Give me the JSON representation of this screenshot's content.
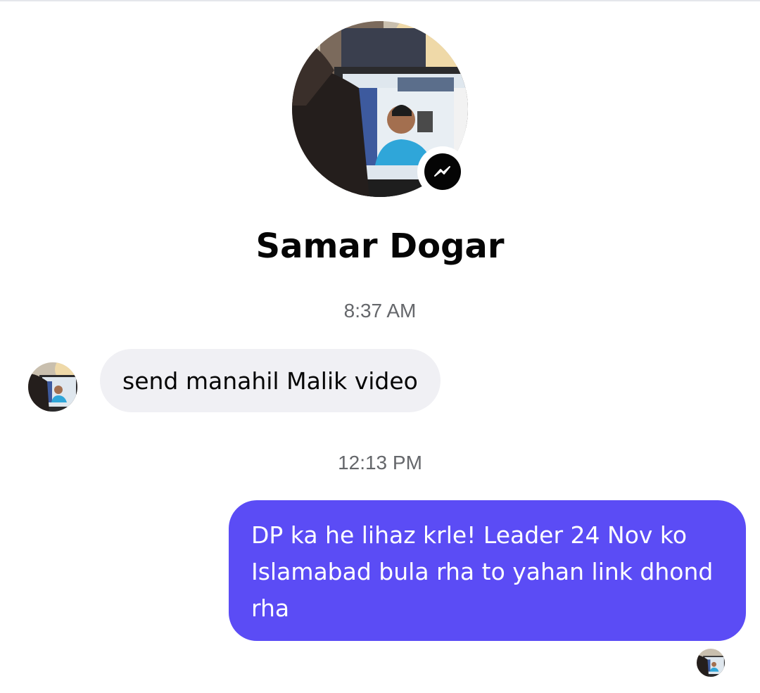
{
  "contact": {
    "name": "Samar Dogar",
    "avatar_icon": "profile-photo",
    "badge_icon": "messenger-icon"
  },
  "conversation": [
    {
      "type": "timestamp",
      "text": "8:37 AM"
    },
    {
      "type": "incoming",
      "text": "send manahil Malik video"
    },
    {
      "type": "timestamp",
      "text": "12:13 PM"
    },
    {
      "type": "outgoing",
      "text": "DP ka he lihaz krle! Leader 24 Nov ko Islamabad bula rha to yahan link dhond rha"
    }
  ],
  "colors": {
    "outgoing_bubble": "#5b4cf5",
    "incoming_bubble": "#f0f0f4",
    "timestamp_text": "#65676b"
  }
}
